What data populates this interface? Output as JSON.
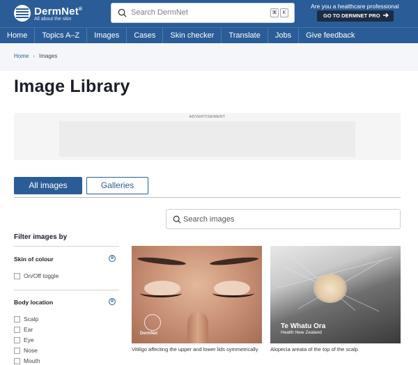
{
  "header": {
    "logo_name": "DermNet",
    "logo_reg": "®",
    "logo_tagline": "All about the skin",
    "search_placeholder": "Search DermNet",
    "shortcut_key1": "⌘",
    "shortcut_key2": "K",
    "pro_question": "Are you a healthcare professional",
    "pro_button": "GO TO DERMNET PRO",
    "pro_arrow": "➔"
  },
  "nav": {
    "items": [
      "Home",
      "Topics A–Z",
      "Images",
      "Cases",
      "Skin checker",
      "Translate",
      "Jobs",
      "Give feedback"
    ]
  },
  "breadcrumb": {
    "home": "Home",
    "separator": "›",
    "current": "Images"
  },
  "page": {
    "title": "Image Library",
    "ad_label": "ADVERTISEMENT"
  },
  "tabs": {
    "all": "All images",
    "galleries": "Galleries"
  },
  "image_search": {
    "placeholder": "Search images"
  },
  "filters": {
    "title": "Filter images by",
    "skin_of_colour": {
      "heading": "Skin of colour",
      "clear": "⊗",
      "option": "On/Off toggle"
    },
    "body_location": {
      "heading": "Body location",
      "clear": "⊗",
      "options": [
        "Scalp",
        "Ear",
        "Eye",
        "Nose",
        "Mouth"
      ]
    }
  },
  "images": [
    {
      "caption": "Vitiligo affecting the upper and lower lids symmetrically",
      "watermark": "DermNet"
    },
    {
      "caption": "Alopecia areata of the top of the scalp",
      "brand_name": "Te Whatu Ora",
      "brand_sub": "Health New Zealand"
    }
  ],
  "colors": {
    "brand_blue": "#2a5d97",
    "pro_button_bg": "#1c2c44"
  }
}
